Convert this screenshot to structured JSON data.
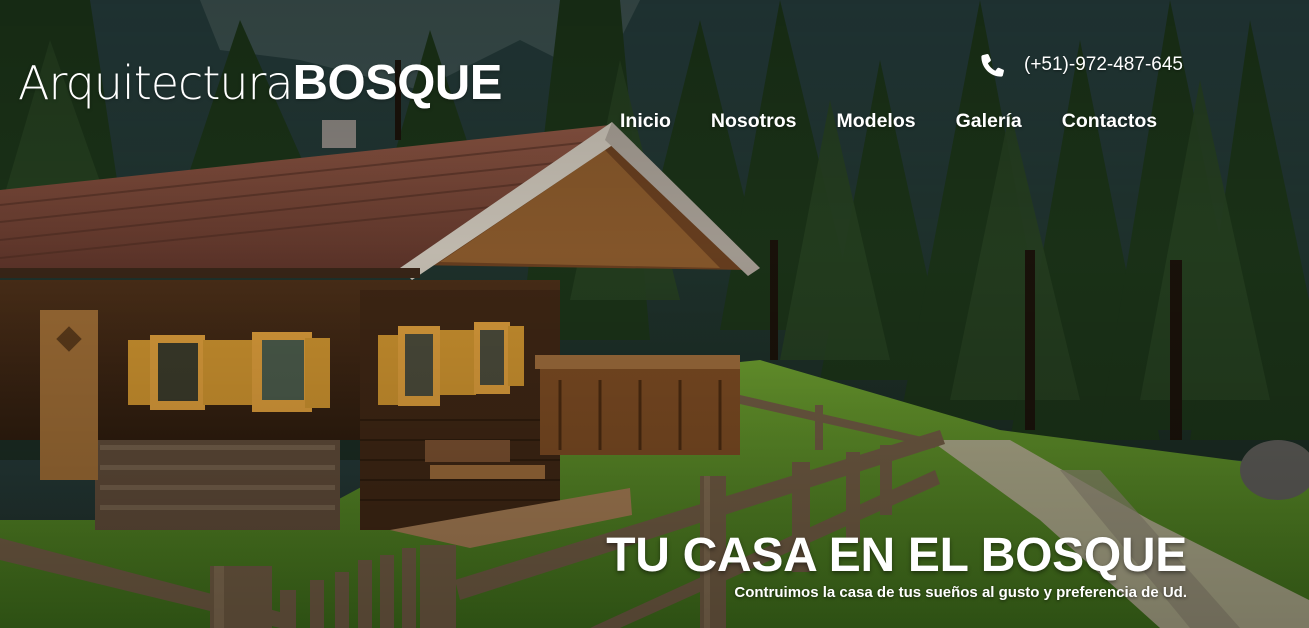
{
  "brand": {
    "logo_light": "Arquitectura",
    "logo_bold": "BOSQUE"
  },
  "contact": {
    "phone": "(+51)-972-487-645",
    "icon": "phone-icon"
  },
  "nav": {
    "items": [
      {
        "label": "Inicio"
      },
      {
        "label": "Nosotros"
      },
      {
        "label": "Modelos"
      },
      {
        "label": "Galería"
      },
      {
        "label": "Contactos"
      }
    ]
  },
  "hero": {
    "title": "TU CASA EN EL BOSQUE",
    "subtitle": "Contruimos la casa de tus sueños al gusto y preferencia de Ud."
  },
  "colors": {
    "text": "#ffffff",
    "forest_dark": "#0f1a0c",
    "roof": "#7a4a3a",
    "wood": "#8b5a2b",
    "grass": "#5a8a2a"
  }
}
